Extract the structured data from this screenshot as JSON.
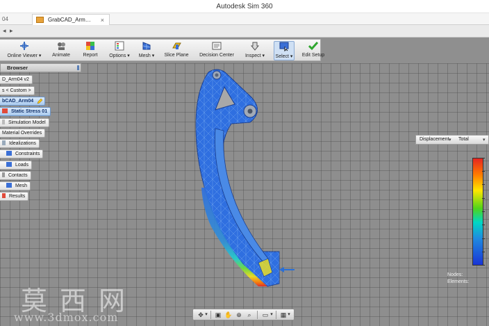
{
  "window": {
    "title": "Autodesk Sim 360"
  },
  "tabs": {
    "previous": "04",
    "active": "GrabCAD_Arm…",
    "close_glyph": "×"
  },
  "quickbar": {
    "back": "◂",
    "forward": "▸"
  },
  "ribbon": {
    "buttons": [
      {
        "label": "Online Viewer ▾",
        "icon": "online-viewer-icon"
      },
      {
        "label": "Animate",
        "icon": "animate-icon"
      },
      {
        "label": "Report",
        "icon": "report-icon"
      },
      {
        "label": "Options ▾",
        "icon": "options-icon"
      },
      {
        "label": "Mesh ▾",
        "icon": "mesh-icon"
      },
      {
        "label": "Slice Plane",
        "icon": "slice-plane-icon"
      },
      {
        "label": "Decision Center",
        "icon": "decision-center-icon"
      },
      {
        "label": "Inspect ▾",
        "icon": "inspect-icon"
      },
      {
        "label": "Select ▾",
        "icon": "select-icon"
      },
      {
        "label": "Edit Setup",
        "icon": "edit-setup-icon"
      }
    ]
  },
  "browser": {
    "title": "Browser",
    "nodes": [
      {
        "label": "D_Arm04 v2"
      },
      {
        "label": "s < Custom >"
      },
      {
        "label": "bCAD_Arm04"
      },
      {
        "label": "Static Stress 01"
      },
      {
        "label": "Simulation Model"
      },
      {
        "label": "Material Overrides"
      },
      {
        "label": "Idealizations"
      },
      {
        "label": "Constraints"
      },
      {
        "label": "Loads"
      },
      {
        "label": "Contacts"
      },
      {
        "label": "Mesh"
      },
      {
        "label": "Results"
      }
    ]
  },
  "results": {
    "result_type": "Displacement",
    "component": "Total",
    "nodes_label": "Nodes:",
    "elements_label": "Elements:"
  },
  "colors": {
    "part_blue": "#2f6fe0",
    "mesh_edge": "#7fb3f0",
    "stress_red": "#e52521",
    "load_arrow": "#2a6fd6"
  },
  "watermark": {
    "chars": "莫西网",
    "url": "www.3dmox.com"
  }
}
